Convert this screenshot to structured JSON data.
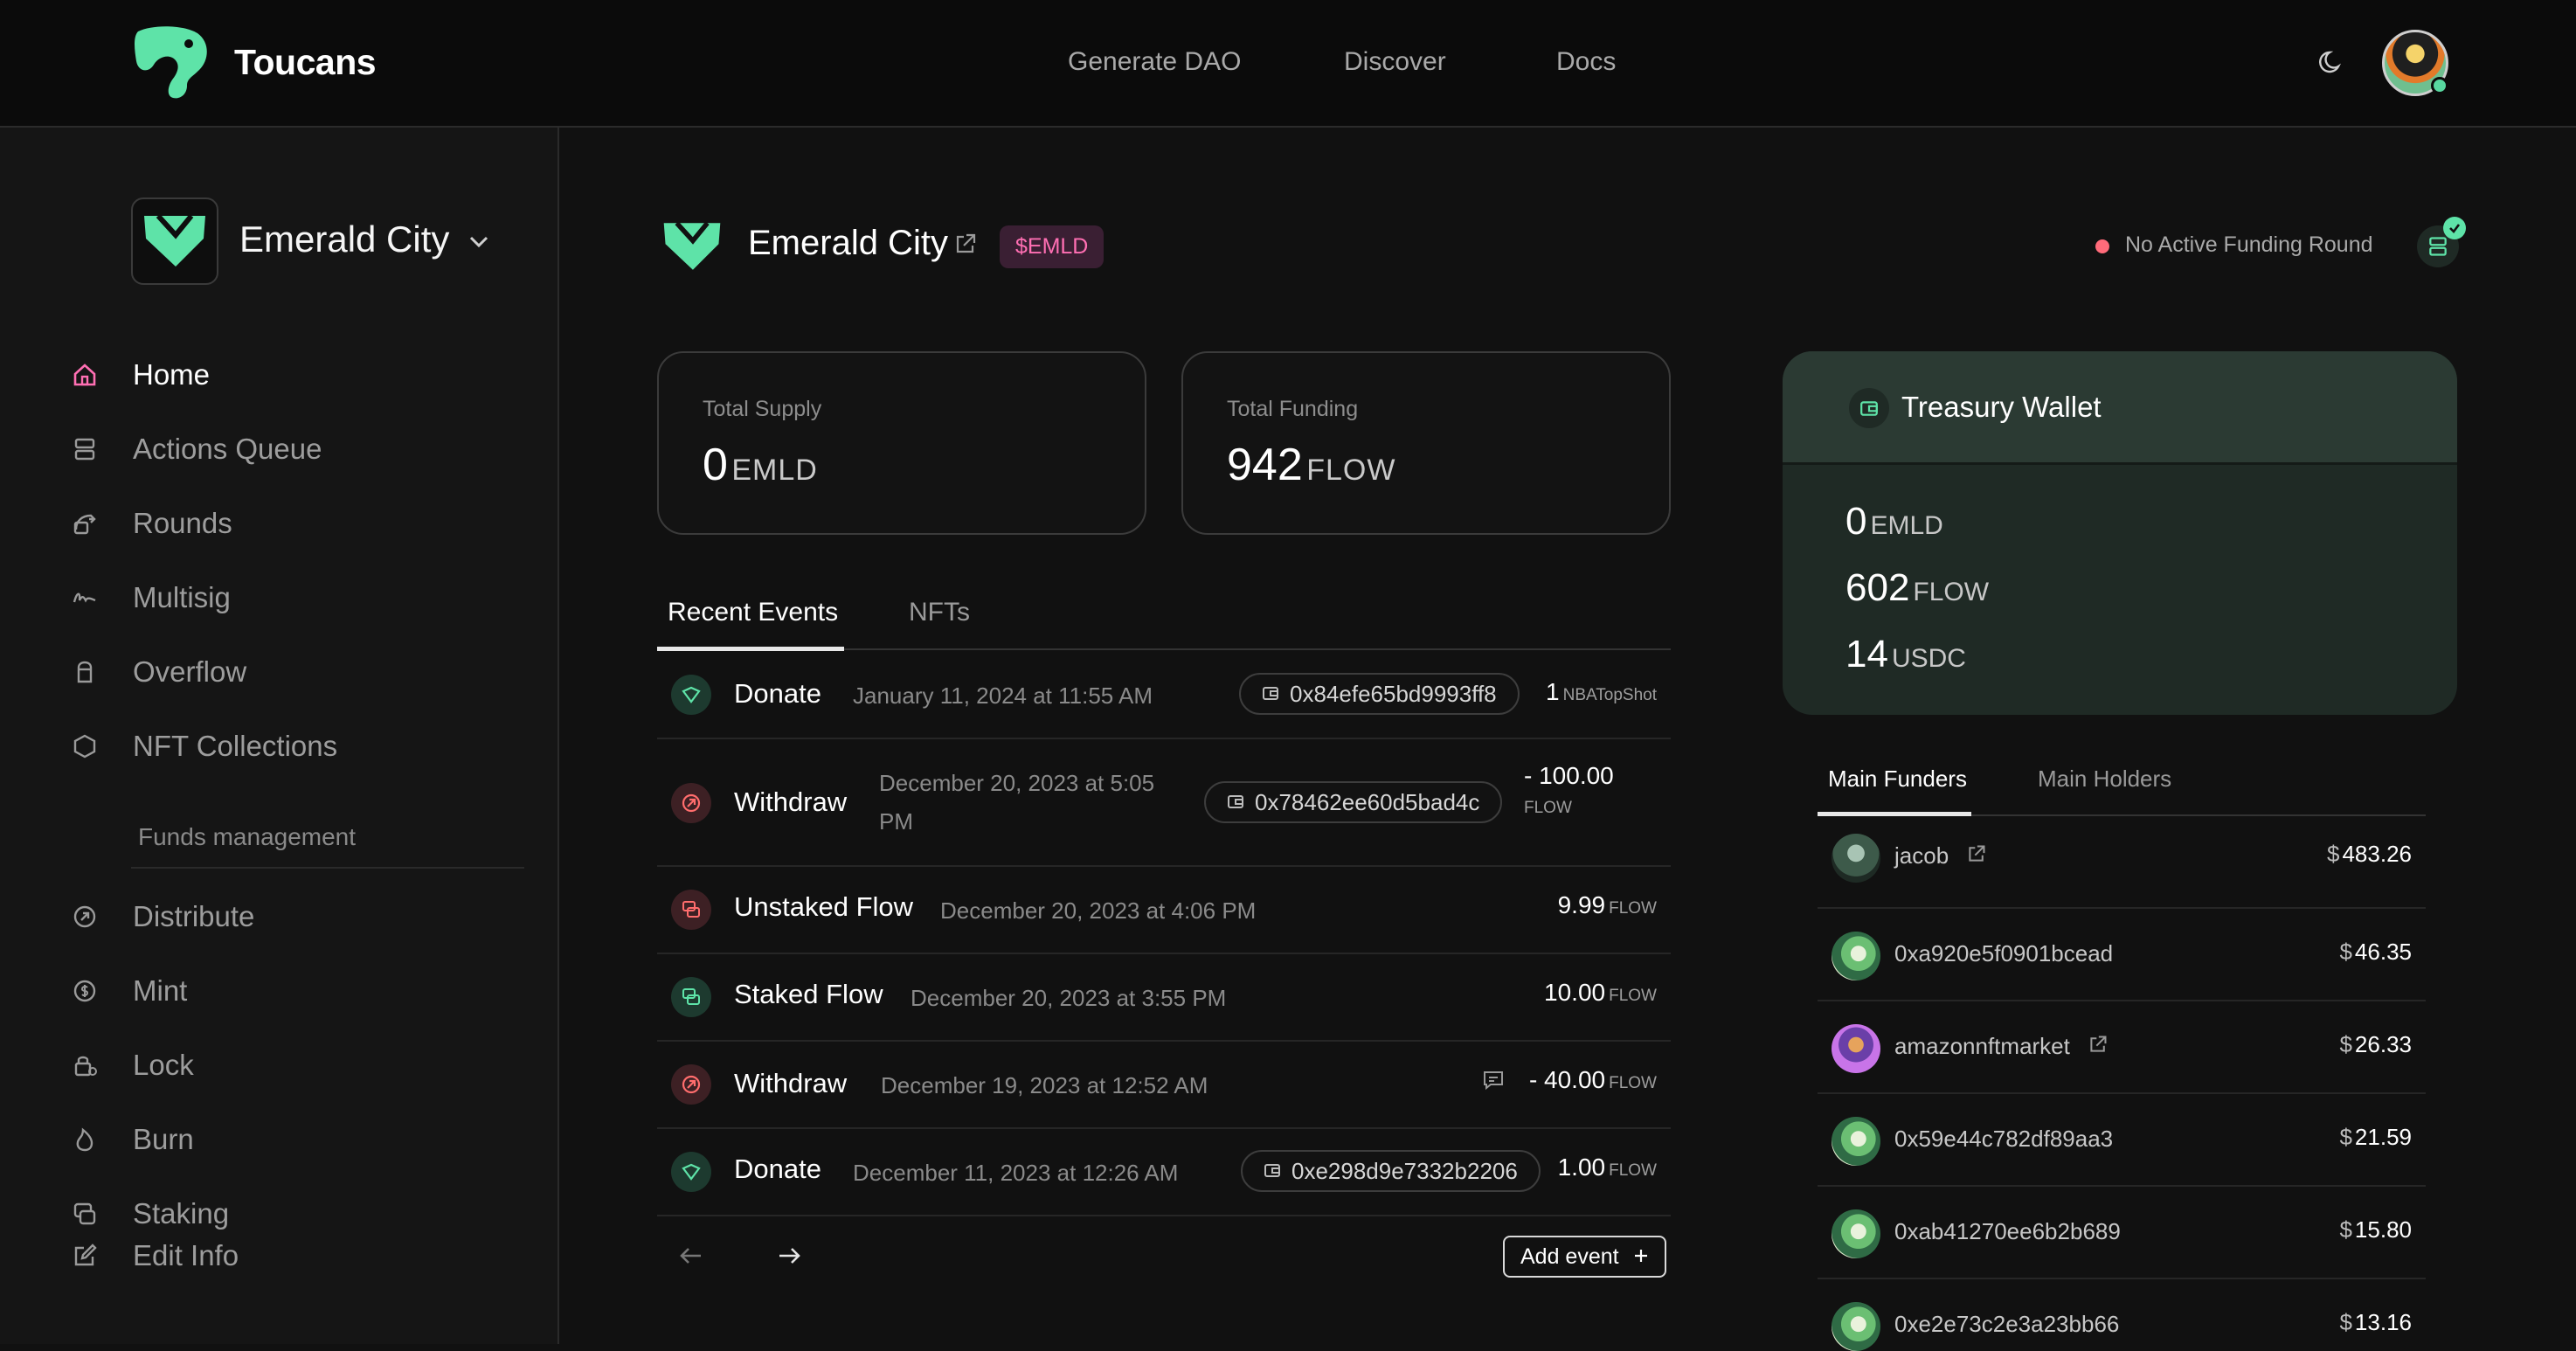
{
  "brand": {
    "name": "Toucans",
    "accent": "#5ee3a8"
  },
  "nav": {
    "links": [
      "Generate DAO",
      "Discover",
      "Docs"
    ]
  },
  "sidebar": {
    "dao_name": "Emerald City",
    "items": [
      {
        "label": "Home",
        "icon": "home-icon",
        "active": true
      },
      {
        "label": "Actions Queue",
        "icon": "queue-icon"
      },
      {
        "label": "Rounds",
        "icon": "rounds-icon"
      },
      {
        "label": "Multisig",
        "icon": "signature-icon"
      },
      {
        "label": "Overflow",
        "icon": "overflow-icon"
      },
      {
        "label": "NFT Collections",
        "icon": "hexagon-icon"
      }
    ],
    "section_title": "Funds management",
    "funds_items": [
      {
        "label": "Distribute",
        "icon": "distribute-icon"
      },
      {
        "label": "Mint",
        "icon": "coin-icon"
      },
      {
        "label": "Lock",
        "icon": "lock-icon"
      },
      {
        "label": "Burn",
        "icon": "flame-icon"
      },
      {
        "label": "Staking",
        "icon": "staking-icon"
      },
      {
        "label": "Edit Info",
        "icon": "edit-icon"
      }
    ]
  },
  "header": {
    "dao_name": "Emerald City",
    "token_badge": "$EMLD",
    "funding_status": "No Active Funding Round",
    "status_color": "#ff6b7a"
  },
  "stats": {
    "supply": {
      "label": "Total Supply",
      "value": "0",
      "unit": "EMLD"
    },
    "funding": {
      "label": "Total Funding",
      "value": "942",
      "unit": "FLOW"
    }
  },
  "tabs": {
    "events": "Recent Events",
    "nfts": "NFTs"
  },
  "events": [
    {
      "type": "Donate",
      "date": "January 11, 2024 at 11:55 AM",
      "address": "0x84efe65bd9993ff8",
      "amount": "1",
      "unit": "NBATopShot"
    },
    {
      "type": "Withdraw",
      "date_line1": "December 20, 2023 at 5:05",
      "date_line2": "PM",
      "address": "0x78462ee60d5bad4c",
      "amount": "- 100.00",
      "unit": "FLOW"
    },
    {
      "type": "Unstaked Flow",
      "date": "December 20, 2023 at 4:06 PM",
      "amount": "9.99",
      "unit": "FLOW"
    },
    {
      "type": "Staked Flow",
      "date": "December 20, 2023 at 3:55 PM",
      "amount": "10.00",
      "unit": "FLOW"
    },
    {
      "type": "Withdraw",
      "date": "December 19, 2023 at 12:52 AM",
      "amount": "- 40.00",
      "unit": "FLOW"
    },
    {
      "type": "Donate",
      "date": "December 11, 2023 at 12:26 AM",
      "address": "0xe298d9e7332b2206",
      "amount": "1.00",
      "unit": "FLOW"
    }
  ],
  "pager": {
    "add_event": "Add event"
  },
  "treasury": {
    "title": "Treasury Wallet",
    "balances": [
      {
        "value": "0",
        "unit": "EMLD"
      },
      {
        "value": "602",
        "unit": "FLOW"
      },
      {
        "value": "14",
        "unit": "USDC"
      }
    ]
  },
  "funders": {
    "tabs": [
      "Main Funders",
      "Main Holders"
    ],
    "rows": [
      {
        "name": "jacob",
        "amount": "483.26",
        "currency": "$"
      },
      {
        "name": "0xa920e5f0901bcead",
        "amount": "46.35",
        "currency": "$"
      },
      {
        "name": "amazonnftmarket",
        "amount": "26.33",
        "currency": "$"
      },
      {
        "name": "0x59e44c782df89aa3",
        "amount": "21.59",
        "currency": "$"
      },
      {
        "name": "0xab41270ee6b2b689",
        "amount": "15.80",
        "currency": "$"
      },
      {
        "name": "0xe2e73c2e3a23bb66",
        "amount": "13.16",
        "currency": "$"
      }
    ]
  }
}
